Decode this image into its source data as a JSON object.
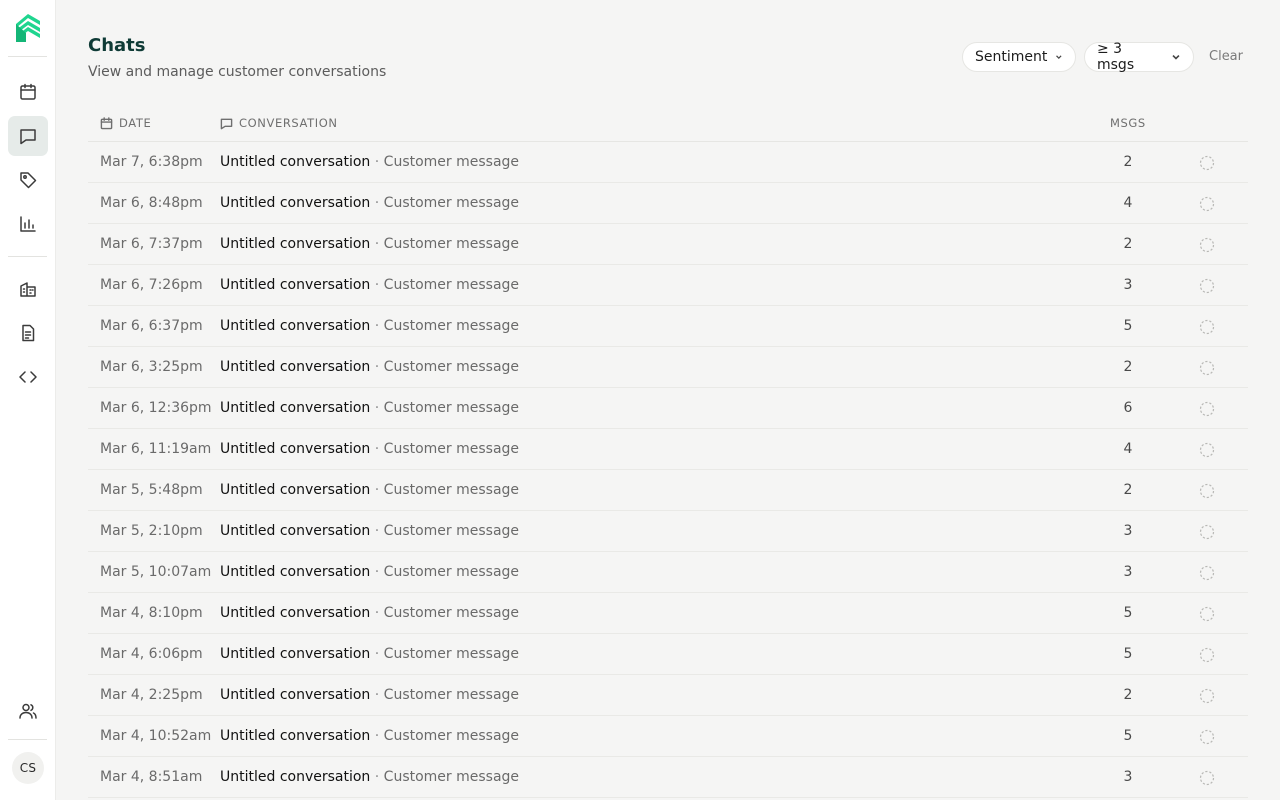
{
  "colors": {
    "brand": "#1fd58f",
    "title": "#0f3b36",
    "active_nav_bg": "#e6ebe9"
  },
  "sidebar": {
    "logo_icon": "brand-logo-icon",
    "nav": [
      {
        "id": "calendar",
        "icon": "calendar-icon",
        "active": false
      },
      {
        "id": "chats",
        "icon": "chat-bubble-icon",
        "active": true
      },
      {
        "id": "tags",
        "icon": "tag-icon",
        "active": false
      },
      {
        "id": "analytics",
        "icon": "bar-chart-icon",
        "active": false
      },
      {
        "id": "organization",
        "icon": "building-icon",
        "active": false
      },
      {
        "id": "documents",
        "icon": "document-icon",
        "active": false
      },
      {
        "id": "developer",
        "icon": "code-icon",
        "active": false
      },
      {
        "id": "users",
        "icon": "users-icon",
        "active": false
      }
    ],
    "avatar_initials": "CS"
  },
  "header": {
    "title": "Chats",
    "subtitle": "View and manage customer conversations",
    "filters": {
      "sentiment_label": "Sentiment",
      "msgs_label": "≥ 3 msgs",
      "clear_label": "Clear"
    }
  },
  "table": {
    "columns": {
      "date": "DATE",
      "conversation": "CONVERSATION",
      "msgs": "MSGS"
    },
    "separator": " · ",
    "rows": [
      {
        "date": "Mar 7, 6:38pm",
        "title": "Untitled conversation",
        "preview": "Customer message",
        "msgs": "2"
      },
      {
        "date": "Mar 6, 8:48pm",
        "title": "Untitled conversation",
        "preview": "Customer message",
        "msgs": "4"
      },
      {
        "date": "Mar 6, 7:37pm",
        "title": "Untitled conversation",
        "preview": "Customer message",
        "msgs": "2"
      },
      {
        "date": "Mar 6, 7:26pm",
        "title": "Untitled conversation",
        "preview": "Customer message",
        "msgs": "3"
      },
      {
        "date": "Mar 6, 6:37pm",
        "title": "Untitled conversation",
        "preview": "Customer message",
        "msgs": "5"
      },
      {
        "date": "Mar 6, 3:25pm",
        "title": "Untitled conversation",
        "preview": "Customer message",
        "msgs": "2"
      },
      {
        "date": "Mar 6, 12:36pm",
        "title": "Untitled conversation",
        "preview": "Customer message",
        "msgs": "6"
      },
      {
        "date": "Mar 6, 11:19am",
        "title": "Untitled conversation",
        "preview": "Customer message",
        "msgs": "4"
      },
      {
        "date": "Mar 5, 5:48pm",
        "title": "Untitled conversation",
        "preview": "Customer message",
        "msgs": "2"
      },
      {
        "date": "Mar 5, 2:10pm",
        "title": "Untitled conversation",
        "preview": "Customer message",
        "msgs": "3"
      },
      {
        "date": "Mar 5, 10:07am",
        "title": "Untitled conversation",
        "preview": "Customer message",
        "msgs": "3"
      },
      {
        "date": "Mar 4, 8:10pm",
        "title": "Untitled conversation",
        "preview": "Customer message",
        "msgs": "5"
      },
      {
        "date": "Mar 4, 6:06pm",
        "title": "Untitled conversation",
        "preview": "Customer message",
        "msgs": "5"
      },
      {
        "date": "Mar 4, 2:25pm",
        "title": "Untitled conversation",
        "preview": "Customer message",
        "msgs": "2"
      },
      {
        "date": "Mar 4, 10:52am",
        "title": "Untitled conversation",
        "preview": "Customer message",
        "msgs": "5"
      },
      {
        "date": "Mar 4, 8:51am",
        "title": "Untitled conversation",
        "preview": "Customer message",
        "msgs": "3"
      }
    ]
  }
}
